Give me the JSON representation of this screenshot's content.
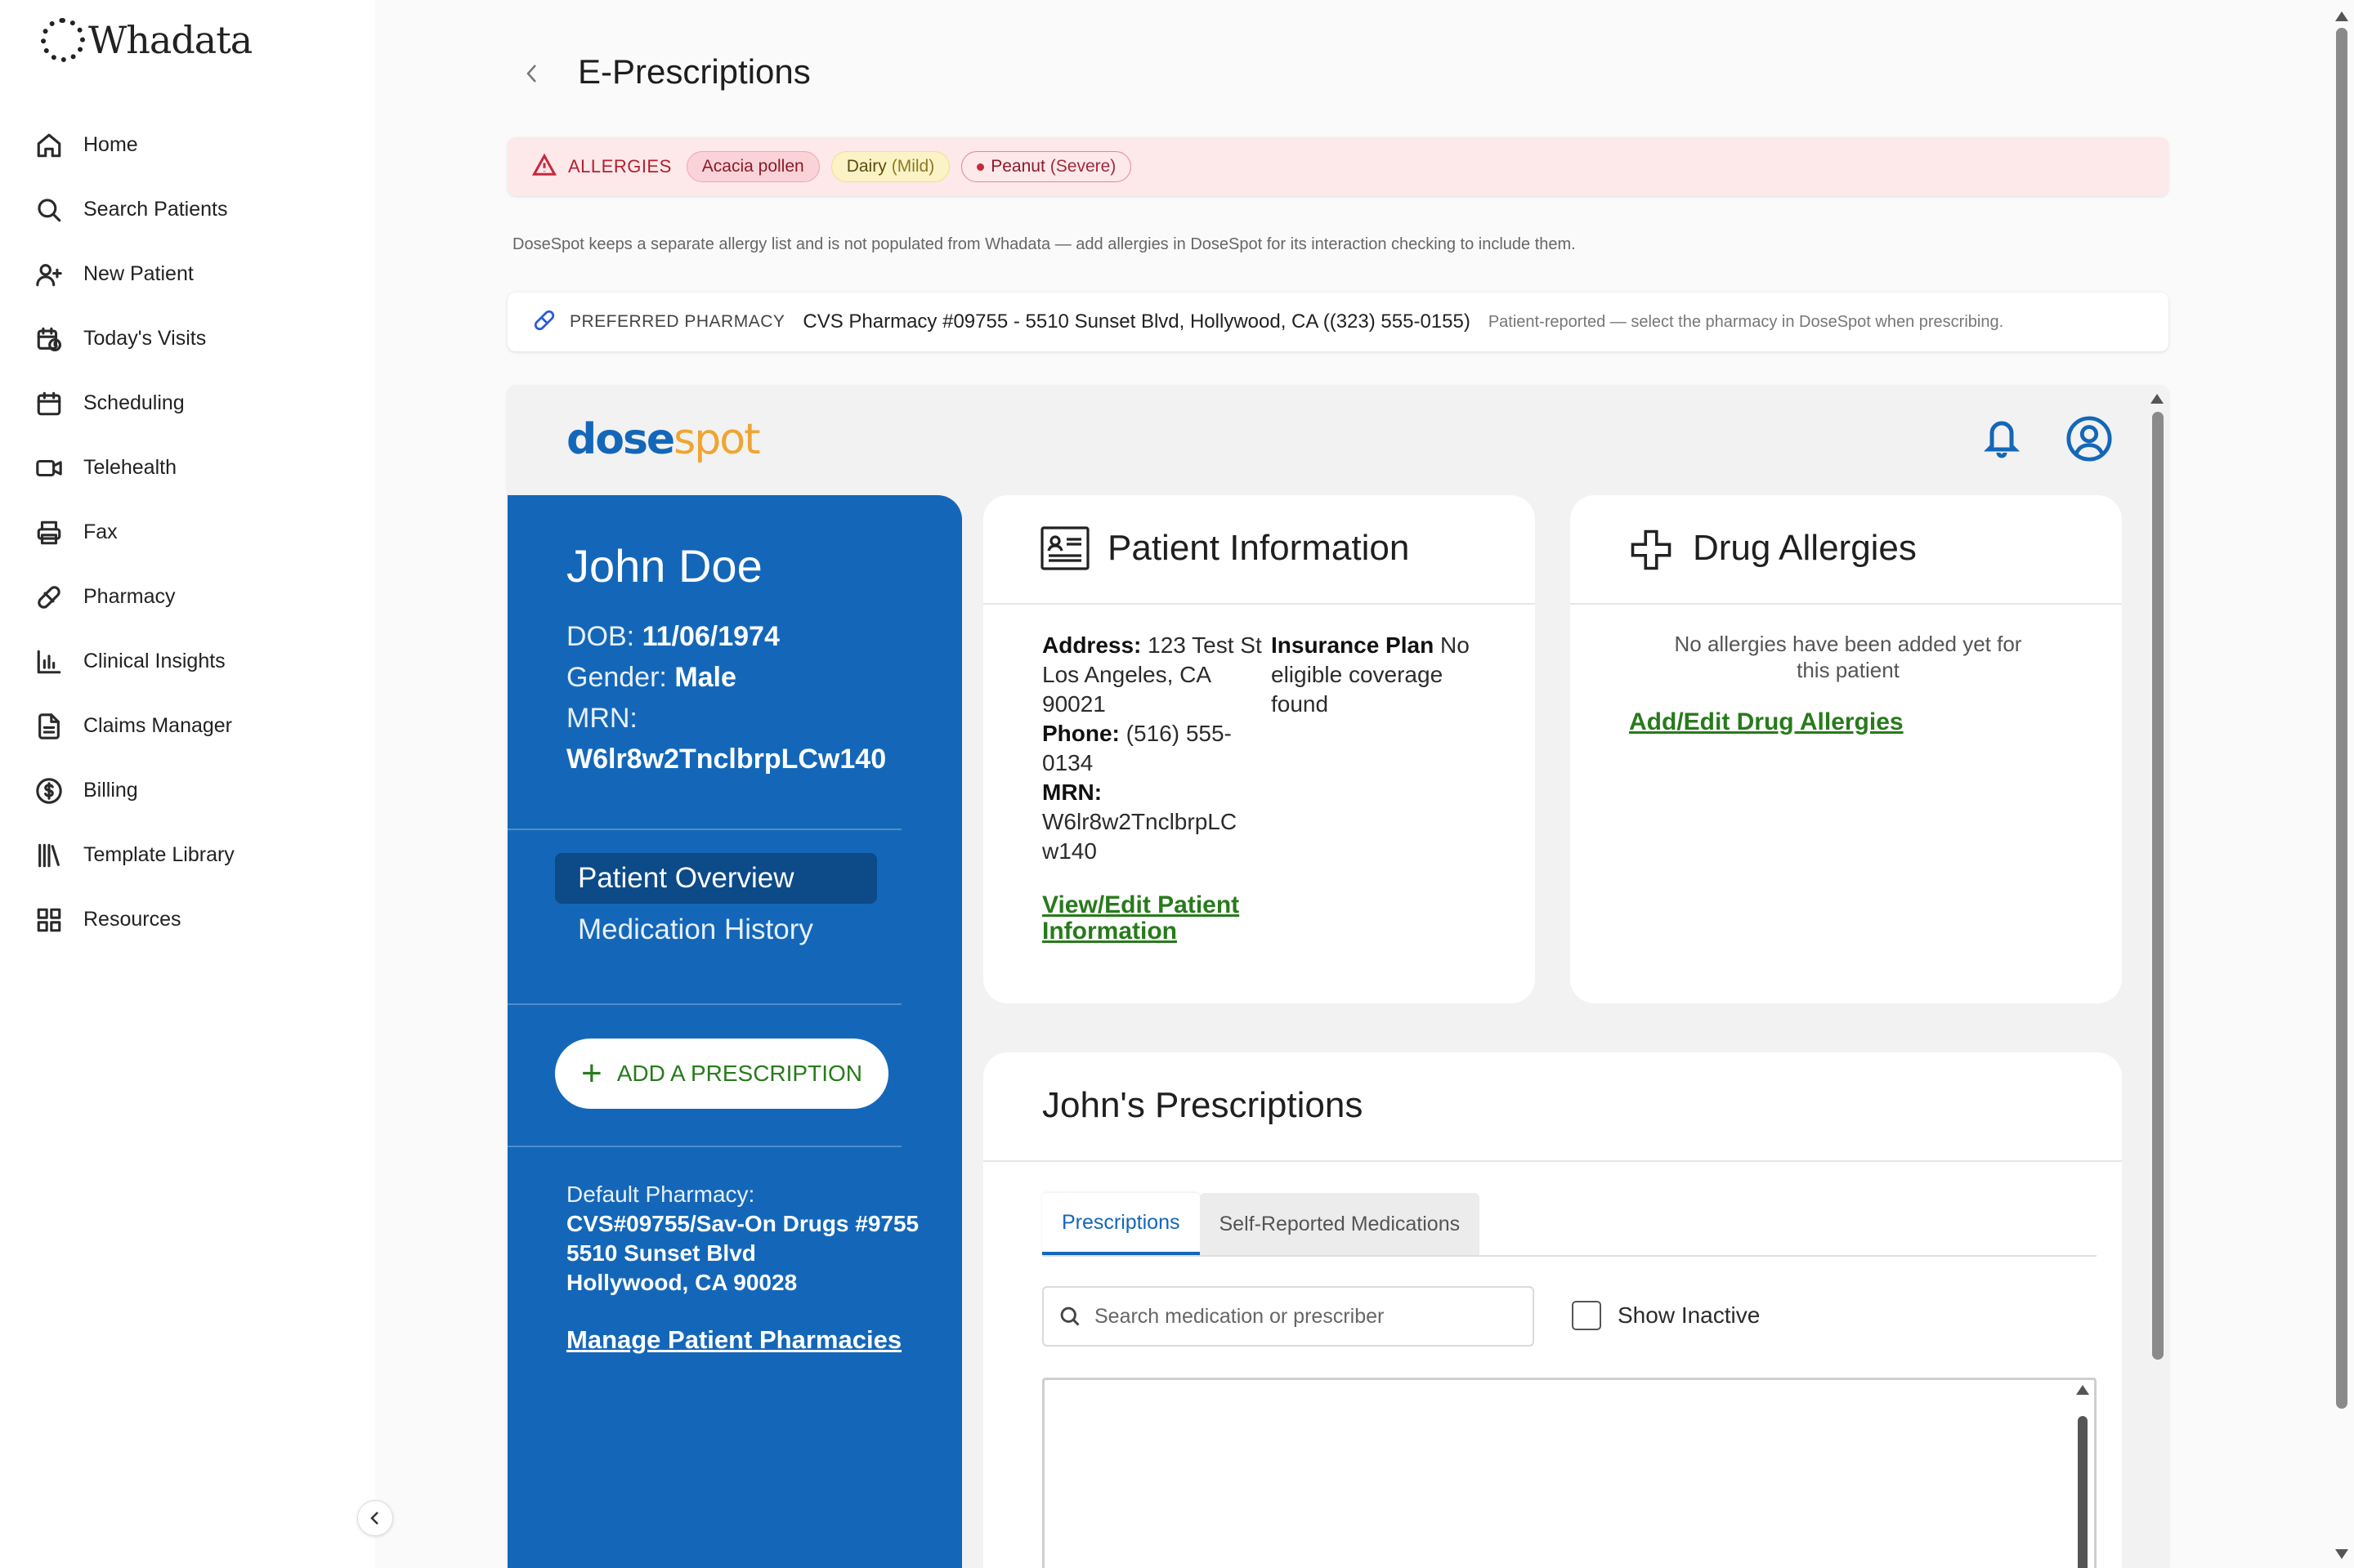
{
  "app": {
    "logo_text": "Whadata"
  },
  "sidebar": {
    "items": [
      {
        "label": "Home",
        "icon": "home-icon"
      },
      {
        "label": "Search Patients",
        "icon": "search-icon"
      },
      {
        "label": "New Patient",
        "icon": "user-plus-icon"
      },
      {
        "label": "Today's Visits",
        "icon": "calendar-clock-icon"
      },
      {
        "label": "Scheduling",
        "icon": "calendar-icon"
      },
      {
        "label": "Telehealth",
        "icon": "video-icon"
      },
      {
        "label": "Fax",
        "icon": "printer-icon"
      },
      {
        "label": "Pharmacy",
        "icon": "pill-icon"
      },
      {
        "label": "Clinical Insights",
        "icon": "bar-chart-icon"
      },
      {
        "label": "Claims Manager",
        "icon": "document-icon"
      },
      {
        "label": "Billing",
        "icon": "dollar-circle-icon"
      },
      {
        "label": "Template Library",
        "icon": "library-icon"
      },
      {
        "label": "Resources",
        "icon": "grid-icon"
      }
    ]
  },
  "header": {
    "title": "E-Prescriptions"
  },
  "allergies": {
    "label": "ALLERGIES",
    "chips": [
      {
        "name": "Acacia pollen",
        "severity": ""
      },
      {
        "name": "Dairy",
        "severity": "(Mild)"
      },
      {
        "name": "Peanut",
        "severity": "(Severe)"
      }
    ],
    "note": "DoseSpot keeps a separate allergy list and is not populated from Whadata — add allergies in DoseSpot for its interaction checking to include them."
  },
  "preferred_pharmacy": {
    "label": "PREFERRED PHARMACY",
    "value": "CVS Pharmacy #09755 - 5510 Sunset Blvd, Hollywood, CA ((323) 555-0155)",
    "hint": "Patient-reported — select the pharmacy in DoseSpot when prescribing."
  },
  "dosespot": {
    "logo_part1": "dose",
    "logo_part2": "spot",
    "patient": {
      "name": "John Doe",
      "dob_label": "DOB:",
      "dob": "11/06/1974",
      "gender_label": "Gender:",
      "gender": "Male",
      "mrn_label": "MRN:",
      "mrn": "W6lr8w2TnclbrpLCw140"
    },
    "nav": {
      "overview": "Patient Overview",
      "history": "Medication History"
    },
    "add_rx_label": "ADD A PRESCRIPTION",
    "default_pharmacy": {
      "label": "Default Pharmacy:",
      "line1": "CVS#09755/Sav-On Drugs #9755",
      "line2": "5510 Sunset Blvd",
      "line3": "Hollywood, CA 90028",
      "manage_link": "Manage Patient Pharmacies"
    },
    "patient_info": {
      "title": "Patient Information",
      "address_label": "Address:",
      "address_line1": "123 Test St",
      "address_line2": "Los Angeles, CA",
      "address_line3": "90021",
      "phone_label": "Phone:",
      "phone_part1": "(516) 555-",
      "phone_part2": "0134",
      "mrn_label": "MRN:",
      "mrn_part1": "W6lr8w2TnclbrpLC",
      "mrn_part2": "w140",
      "insurance_label": "Insurance Plan",
      "insurance_part1": "No",
      "insurance_part2": "eligible coverage",
      "insurance_part3": "found",
      "edit_link_line1": "View/Edit Patient",
      "edit_link_line2": "Information"
    },
    "drug_allergies": {
      "title": "Drug Allergies",
      "empty_line1": "No allergies have been added yet for",
      "empty_line2": "this patient",
      "edit_link": "Add/Edit Drug Allergies"
    },
    "prescriptions": {
      "title": "John's Prescriptions",
      "tabs": [
        "Prescriptions",
        "Self-Reported Medications"
      ],
      "search_placeholder": "Search medication or prescriber",
      "show_inactive_label": "Show Inactive"
    }
  },
  "colors": {
    "dosespot_blue": "#1467b8",
    "dosespot_orange": "#f0a532",
    "link_green": "#287a1c",
    "allergy_red": "#c42a3d"
  }
}
